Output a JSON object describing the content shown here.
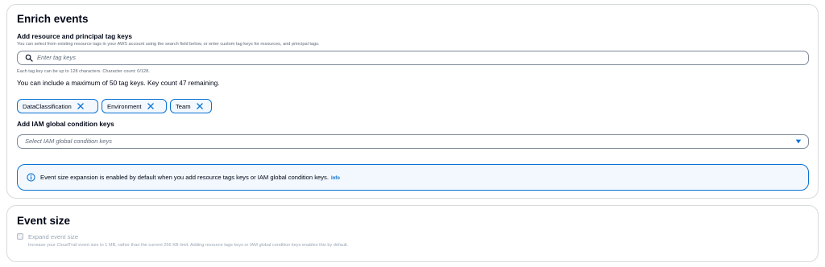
{
  "enrich": {
    "title": "Enrich events",
    "tag_keys": {
      "label": "Add resource and principal tag keys",
      "description": "You can select from existing resource tags in your AWS account using the search field below, or enter custom tag keys for resources, and principal tags.",
      "placeholder": "Enter tag keys",
      "char_constraint": "Each tag key can be up to 128 characters. Character count: 0/128.",
      "limit_text": "You can include a maximum of 50 tag keys. Key count 47 remaining.",
      "tokens": [
        {
          "label": "DataClassification"
        },
        {
          "label": "Environment"
        },
        {
          "label": "Team"
        }
      ]
    },
    "iam_keys": {
      "label": "Add IAM global condition keys",
      "placeholder": "Select IAM global condition keys"
    },
    "info": {
      "message": "Event size expansion is enabled by default when you add resource tags keys or IAM global condition keys.",
      "link": "Info"
    }
  },
  "event_size": {
    "title": "Event size",
    "checkbox_label": "Expand event size",
    "checkbox_checked": true,
    "checkbox_disabled": true,
    "description": "Increase your CloudTrail event size to 1 MB, rather than the current 256 KB limit. Adding resource tags keys or IAM global condition keys enables this by default."
  },
  "colors": {
    "accent": "#0972d3",
    "text": "#000716",
    "muted": "#5f6b7a",
    "border": "#7d8998"
  },
  "icons": {
    "search": "search-icon",
    "token_remove": "close-icon",
    "dropdown": "caret-down-icon",
    "info": "info-icon",
    "checkbox": "check-icon"
  }
}
